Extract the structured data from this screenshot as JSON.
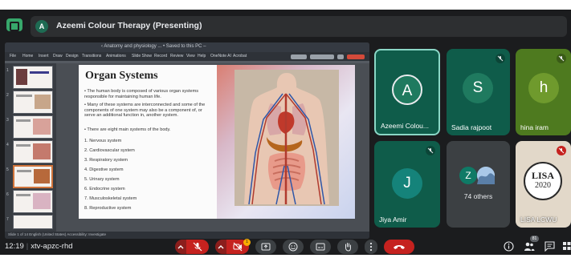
{
  "meeting": {
    "title": "Azeemi Colour Therapy (Presenting)",
    "presenter_initial": "A",
    "time": "12:19",
    "separator": "|",
    "code": "xtv-apzc-rhd"
  },
  "presentation": {
    "window_title": "‹ Anatomy and physiology ... • Saved to this PC –",
    "ribbon_tabs": [
      "File",
      "Home",
      "Insert",
      "Draw",
      "Design",
      "Transitions",
      "Animations",
      "Slide Show",
      "Record",
      "Review",
      "View",
      "Help",
      "OneNote AI",
      "Acrobat"
    ],
    "status_text": "Slide 1 of 14    English (United States)    Accessibility: Investigate",
    "thumbnail_numbers": [
      "1",
      "2",
      "3",
      "4",
      "5",
      "6",
      "7"
    ],
    "slide": {
      "heading": "Organ Systems",
      "bullets": [
        "The human body is composed of various organ systems responsible for maintaining human life.",
        "Many of these systems are interconnected and some of the components of one system may also be a component of, or serve an additional function in, another system.",
        "There are eight main systems of the body."
      ],
      "systems": [
        "1.  Nervous system",
        "2.  Cardiovascular system",
        "3.  Respiratory system",
        "4.  Digestive system",
        "5.  Urinary system",
        "6.  Endocrine system",
        "7.  Musculoskeletal system",
        "8.  Reproductive system"
      ]
    }
  },
  "participants": [
    {
      "name": "Azeemi Colou...",
      "initial": "A",
      "color": "#0f5c4a",
      "avatar_color": "#1f7a5f"
    },
    {
      "name": "Sadia rajpoot",
      "initial": "S",
      "color": "#0f5c4a",
      "avatar_color": "#1f7a5f"
    },
    {
      "name": "hina iram",
      "initial": "h",
      "color": "#4e7a1f",
      "avatar_color": "#6f9a2d"
    },
    {
      "name": "Jiya Amir",
      "initial": "J",
      "color": "#0f5c4a",
      "avatar_color": "#15837a"
    },
    {
      "name": "74 others",
      "initial": "Z"
    },
    {
      "name": "LISA LCWU",
      "logo_text": "LISA",
      "logo_year": "2020"
    }
  ],
  "controls": {
    "reaction_badge": "1",
    "participant_count": "81"
  },
  "colors": {
    "background": "#1b1c1e",
    "control_dark": "#3c4043",
    "end_call_red": "#c5221f",
    "tile_green": "#0f5c4a",
    "tile_olive": "#4e7a1f",
    "active_speaker_border": "#8ad7c6"
  },
  "icons": {
    "app": "meet-logo-icon",
    "mic": "mic-off-icon",
    "camera": "camera-off-icon",
    "present": "present-screen-icon",
    "emoji": "emoji-icon",
    "captions": "captions-icon",
    "hand": "raise-hand-icon",
    "more": "more-vert-icon",
    "end_call": "end-call-icon",
    "info": "info-icon",
    "people": "people-icon",
    "chat": "chat-icon",
    "activities": "activities-icon"
  }
}
